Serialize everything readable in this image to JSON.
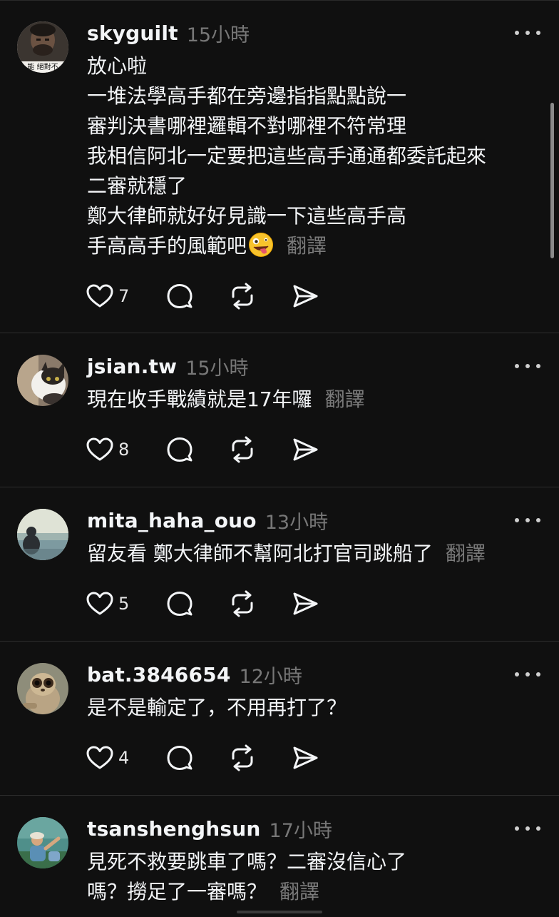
{
  "colors": {
    "background": "#101010",
    "text": "#f3f5f7",
    "muted": "#777777",
    "divider": "#2d2d2d"
  },
  "posts": [
    {
      "username": "skyguilt",
      "time": "15小時",
      "avatar_icon": "avatar-man-photo",
      "lines": [
        "放心啦",
        "一堆法學高手都在旁邊指指點點說一",
        "審判決書哪裡邏輯不對哪裡不符常理",
        "我相信阿北一定要把這些高手通通都委託起來",
        "二審就穩了",
        "鄭大律師就好好見識一下這些高手高",
        "手高高手的風範吧"
      ],
      "emoji": "zany-face-emoji",
      "translate": "翻譯",
      "likes": "7"
    },
    {
      "username": "jsian.tw",
      "time": "15小時",
      "avatar_icon": "avatar-cat-photo",
      "lines": [
        "現在收手戰績就是17年囉"
      ],
      "translate": "翻譯",
      "likes": "8"
    },
    {
      "username": "mita_haha_ouo",
      "time": "13小時",
      "avatar_icon": "avatar-seaside-photo",
      "lines": [
        "留友看 鄭大律師不幫阿北打官司跳船了"
      ],
      "translate": "翻譯",
      "likes": "5"
    },
    {
      "username": "bat.3846654",
      "time": "12小時",
      "avatar_icon": "avatar-loris-photo",
      "lines": [
        "是不是輸定了，不用再打了？"
      ],
      "translate": "",
      "likes": "4"
    },
    {
      "username": "tsanshenghsun",
      "time": "17小時",
      "avatar_icon": "avatar-outdoor-photo",
      "lines": [
        "見死不救要跳車了嗎？二審沒信心了",
        "嗎？撈足了一審嗎？"
      ],
      "translate": "翻譯",
      "likes": ""
    }
  ]
}
